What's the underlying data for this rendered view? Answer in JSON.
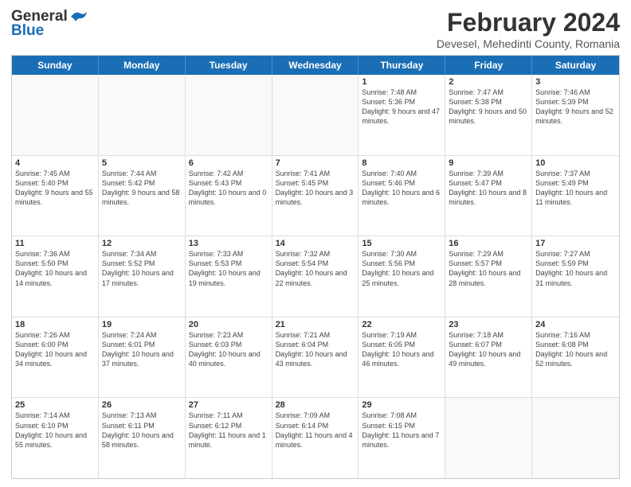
{
  "header": {
    "logo_general": "General",
    "logo_blue": "Blue",
    "title": "February 2024",
    "subtitle": "Devesel, Mehedinti County, Romania"
  },
  "calendar": {
    "days_of_week": [
      "Sunday",
      "Monday",
      "Tuesday",
      "Wednesday",
      "Thursday",
      "Friday",
      "Saturday"
    ],
    "rows": [
      [
        {
          "day": "",
          "info": "",
          "empty": true
        },
        {
          "day": "",
          "info": "",
          "empty": true
        },
        {
          "day": "",
          "info": "",
          "empty": true
        },
        {
          "day": "",
          "info": "",
          "empty": true
        },
        {
          "day": "1",
          "info": "Sunrise: 7:48 AM\nSunset: 5:36 PM\nDaylight: 9 hours and 47 minutes."
        },
        {
          "day": "2",
          "info": "Sunrise: 7:47 AM\nSunset: 5:38 PM\nDaylight: 9 hours and 50 minutes."
        },
        {
          "day": "3",
          "info": "Sunrise: 7:46 AM\nSunset: 5:39 PM\nDaylight: 9 hours and 52 minutes."
        }
      ],
      [
        {
          "day": "4",
          "info": "Sunrise: 7:45 AM\nSunset: 5:40 PM\nDaylight: 9 hours and 55 minutes."
        },
        {
          "day": "5",
          "info": "Sunrise: 7:44 AM\nSunset: 5:42 PM\nDaylight: 9 hours and 58 minutes."
        },
        {
          "day": "6",
          "info": "Sunrise: 7:42 AM\nSunset: 5:43 PM\nDaylight: 10 hours and 0 minutes."
        },
        {
          "day": "7",
          "info": "Sunrise: 7:41 AM\nSunset: 5:45 PM\nDaylight: 10 hours and 3 minutes."
        },
        {
          "day": "8",
          "info": "Sunrise: 7:40 AM\nSunset: 5:46 PM\nDaylight: 10 hours and 6 minutes."
        },
        {
          "day": "9",
          "info": "Sunrise: 7:39 AM\nSunset: 5:47 PM\nDaylight: 10 hours and 8 minutes."
        },
        {
          "day": "10",
          "info": "Sunrise: 7:37 AM\nSunset: 5:49 PM\nDaylight: 10 hours and 11 minutes."
        }
      ],
      [
        {
          "day": "11",
          "info": "Sunrise: 7:36 AM\nSunset: 5:50 PM\nDaylight: 10 hours and 14 minutes."
        },
        {
          "day": "12",
          "info": "Sunrise: 7:34 AM\nSunset: 5:52 PM\nDaylight: 10 hours and 17 minutes."
        },
        {
          "day": "13",
          "info": "Sunrise: 7:33 AM\nSunset: 5:53 PM\nDaylight: 10 hours and 19 minutes."
        },
        {
          "day": "14",
          "info": "Sunrise: 7:32 AM\nSunset: 5:54 PM\nDaylight: 10 hours and 22 minutes."
        },
        {
          "day": "15",
          "info": "Sunrise: 7:30 AM\nSunset: 5:56 PM\nDaylight: 10 hours and 25 minutes."
        },
        {
          "day": "16",
          "info": "Sunrise: 7:29 AM\nSunset: 5:57 PM\nDaylight: 10 hours and 28 minutes."
        },
        {
          "day": "17",
          "info": "Sunrise: 7:27 AM\nSunset: 5:59 PM\nDaylight: 10 hours and 31 minutes."
        }
      ],
      [
        {
          "day": "18",
          "info": "Sunrise: 7:26 AM\nSunset: 6:00 PM\nDaylight: 10 hours and 34 minutes."
        },
        {
          "day": "19",
          "info": "Sunrise: 7:24 AM\nSunset: 6:01 PM\nDaylight: 10 hours and 37 minutes."
        },
        {
          "day": "20",
          "info": "Sunrise: 7:23 AM\nSunset: 6:03 PM\nDaylight: 10 hours and 40 minutes."
        },
        {
          "day": "21",
          "info": "Sunrise: 7:21 AM\nSunset: 6:04 PM\nDaylight: 10 hours and 43 minutes."
        },
        {
          "day": "22",
          "info": "Sunrise: 7:19 AM\nSunset: 6:05 PM\nDaylight: 10 hours and 46 minutes."
        },
        {
          "day": "23",
          "info": "Sunrise: 7:18 AM\nSunset: 6:07 PM\nDaylight: 10 hours and 49 minutes."
        },
        {
          "day": "24",
          "info": "Sunrise: 7:16 AM\nSunset: 6:08 PM\nDaylight: 10 hours and 52 minutes."
        }
      ],
      [
        {
          "day": "25",
          "info": "Sunrise: 7:14 AM\nSunset: 6:10 PM\nDaylight: 10 hours and 55 minutes."
        },
        {
          "day": "26",
          "info": "Sunrise: 7:13 AM\nSunset: 6:11 PM\nDaylight: 10 hours and 58 minutes."
        },
        {
          "day": "27",
          "info": "Sunrise: 7:11 AM\nSunset: 6:12 PM\nDaylight: 11 hours and 1 minute."
        },
        {
          "day": "28",
          "info": "Sunrise: 7:09 AM\nSunset: 6:14 PM\nDaylight: 11 hours and 4 minutes."
        },
        {
          "day": "29",
          "info": "Sunrise: 7:08 AM\nSunset: 6:15 PM\nDaylight: 11 hours and 7 minutes."
        },
        {
          "day": "",
          "info": "",
          "empty": true
        },
        {
          "day": "",
          "info": "",
          "empty": true
        }
      ]
    ]
  }
}
